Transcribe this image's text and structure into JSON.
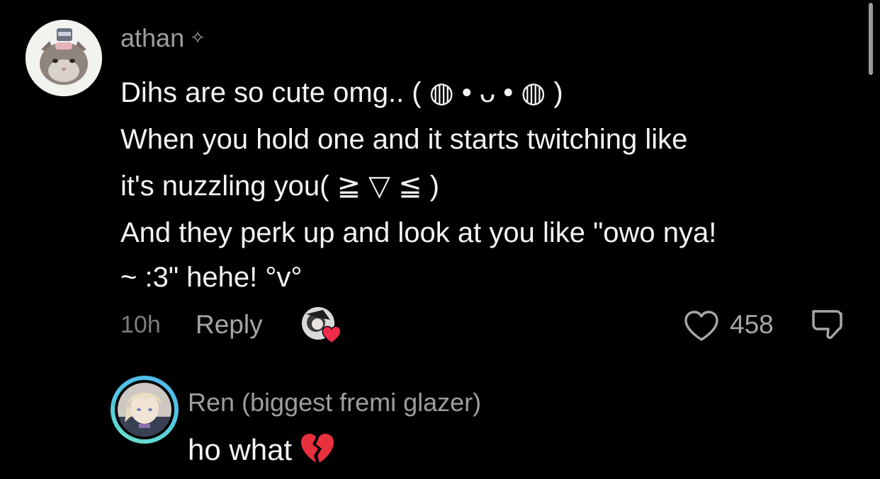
{
  "comment": {
    "username": "athan",
    "username_badge": "✧",
    "lines": [
      "Dihs are so cute omg.. ( ◍ • ᴗ • ◍ )",
      "When you hold one and it starts twitching like",
      "it's nuzzling you( ≧ ▽ ≦ )",
      "And they perk up and look at you like \"owo nya!",
      "~ :3\" hehe! °v°"
    ],
    "timestamp": "10h",
    "reply_label": "Reply",
    "like_count": "458",
    "icons": {
      "like": "heart-outline-icon",
      "dislike": "thumbs-down-icon",
      "creator_liked": "heart-filled-icon"
    }
  },
  "reply": {
    "username": "Ren (biggest fremi glazer)",
    "text": "ho what",
    "emoji": "broken-heart"
  },
  "colors": {
    "background": "#000000",
    "username": "#9e9e9e",
    "body_text": "#f4f4f4",
    "meta_text": "#a6a6a6",
    "timestamp": "#7c7c7c",
    "heart_red": "#f02c4a",
    "ring_start": "#4fb9f2",
    "ring_end": "#6fe3c9"
  }
}
